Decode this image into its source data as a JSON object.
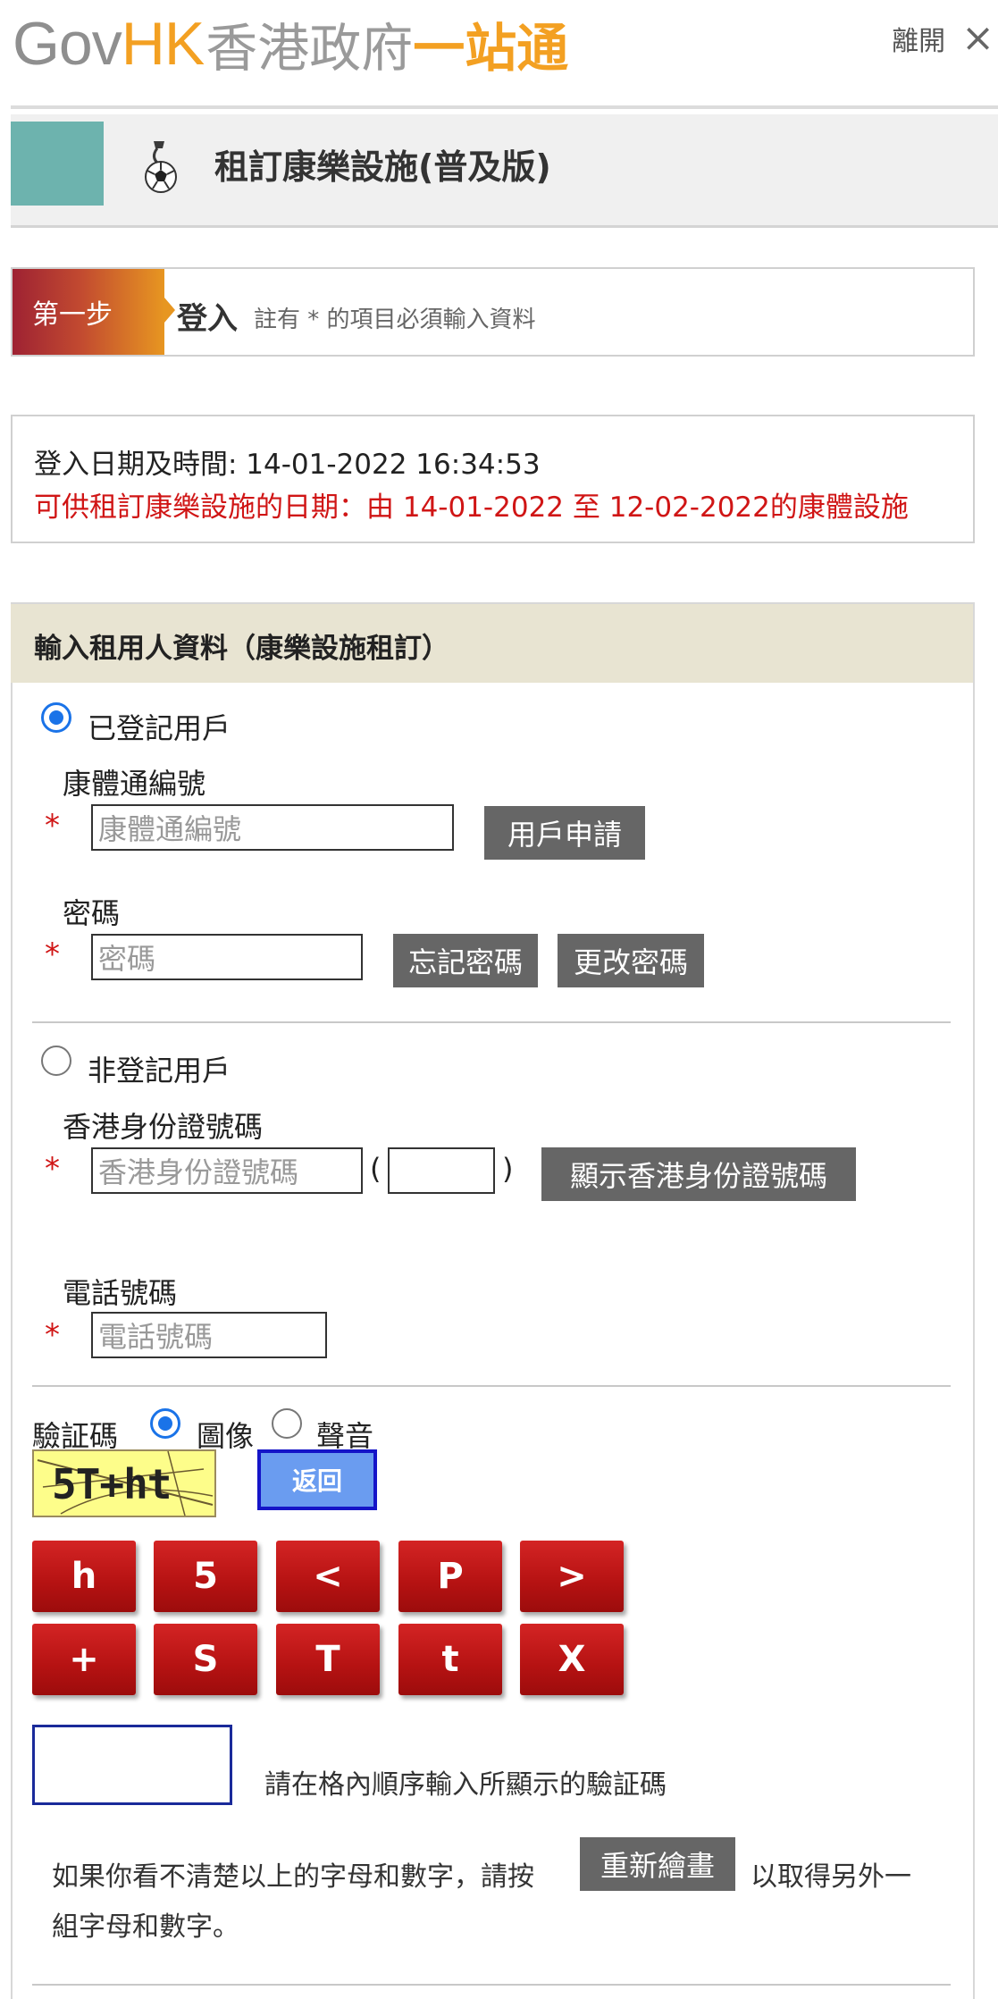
{
  "header": {
    "logo_gov": "Gov",
    "logo_hk": "HK",
    "logo_cn_grey": "香港政府",
    "logo_cn_orange": "一站通",
    "exit_label": "離開",
    "exit_icon": "close-icon"
  },
  "title_bar": {
    "title": "租訂康樂設施(普及版)",
    "icon": "sports-ball-icon"
  },
  "step": {
    "badge": "第一步",
    "name": "登入",
    "note": "註有 * 的項目必須輸入資料"
  },
  "info": {
    "login_datetime": "登入日期及時間: 14-01-2022 16:34:53",
    "booking_period": "可供租訂康樂設施的日期：由 14-01-2022 至 12-02-2022的康體設施"
  },
  "form": {
    "heading": "輸入租用人資料（康樂設施租訂）",
    "registered": {
      "radio_label": "已登記用戶",
      "selected": true,
      "id_label": "康體通編號",
      "id_placeholder": "康體通編號",
      "apply_button": "用戶申請",
      "password_label": "密碼",
      "password_placeholder": "密碼",
      "forgot_button": "忘記密碼",
      "change_button": "更改密碼"
    },
    "unregistered": {
      "radio_label": "非登記用戶",
      "selected": false,
      "hkid_label": "香港身份證號碼",
      "hkid_placeholder": "香港身份證號碼",
      "paren_open": "(",
      "paren_close": ")",
      "show_hkid_button": "顯示香港身份證號碼",
      "phone_label": "電話號碼",
      "phone_placeholder": "電話號碼"
    },
    "required_mark": "*"
  },
  "captcha": {
    "label": "驗証碼",
    "option_image": "圖像",
    "option_audio": "聲音",
    "selected": "圖像",
    "image_text": "5T+ht",
    "back_button": "返回",
    "keys_row1": [
      "h",
      "5",
      "<",
      "P",
      ">"
    ],
    "keys_row2": [
      "+",
      "S",
      "T",
      "t",
      "X"
    ],
    "input_hint": "請在格內順序輸入所顯示的驗証碼",
    "redraw_text_before": "如果你看不清楚以上的字母和數字，請按",
    "redraw_button": "重新繪畫",
    "redraw_text_after": "以取得另外一",
    "redraw_text_line2": "組字母和數字。"
  },
  "colors": {
    "accent_orange": "#f3a022",
    "required_red": "#d01515",
    "radio_blue": "#1a73e8",
    "button_grey": "#666666",
    "key_red": "#c41818",
    "form_header_bg": "#e8e4d2",
    "teal_block": "#6db3ae"
  }
}
